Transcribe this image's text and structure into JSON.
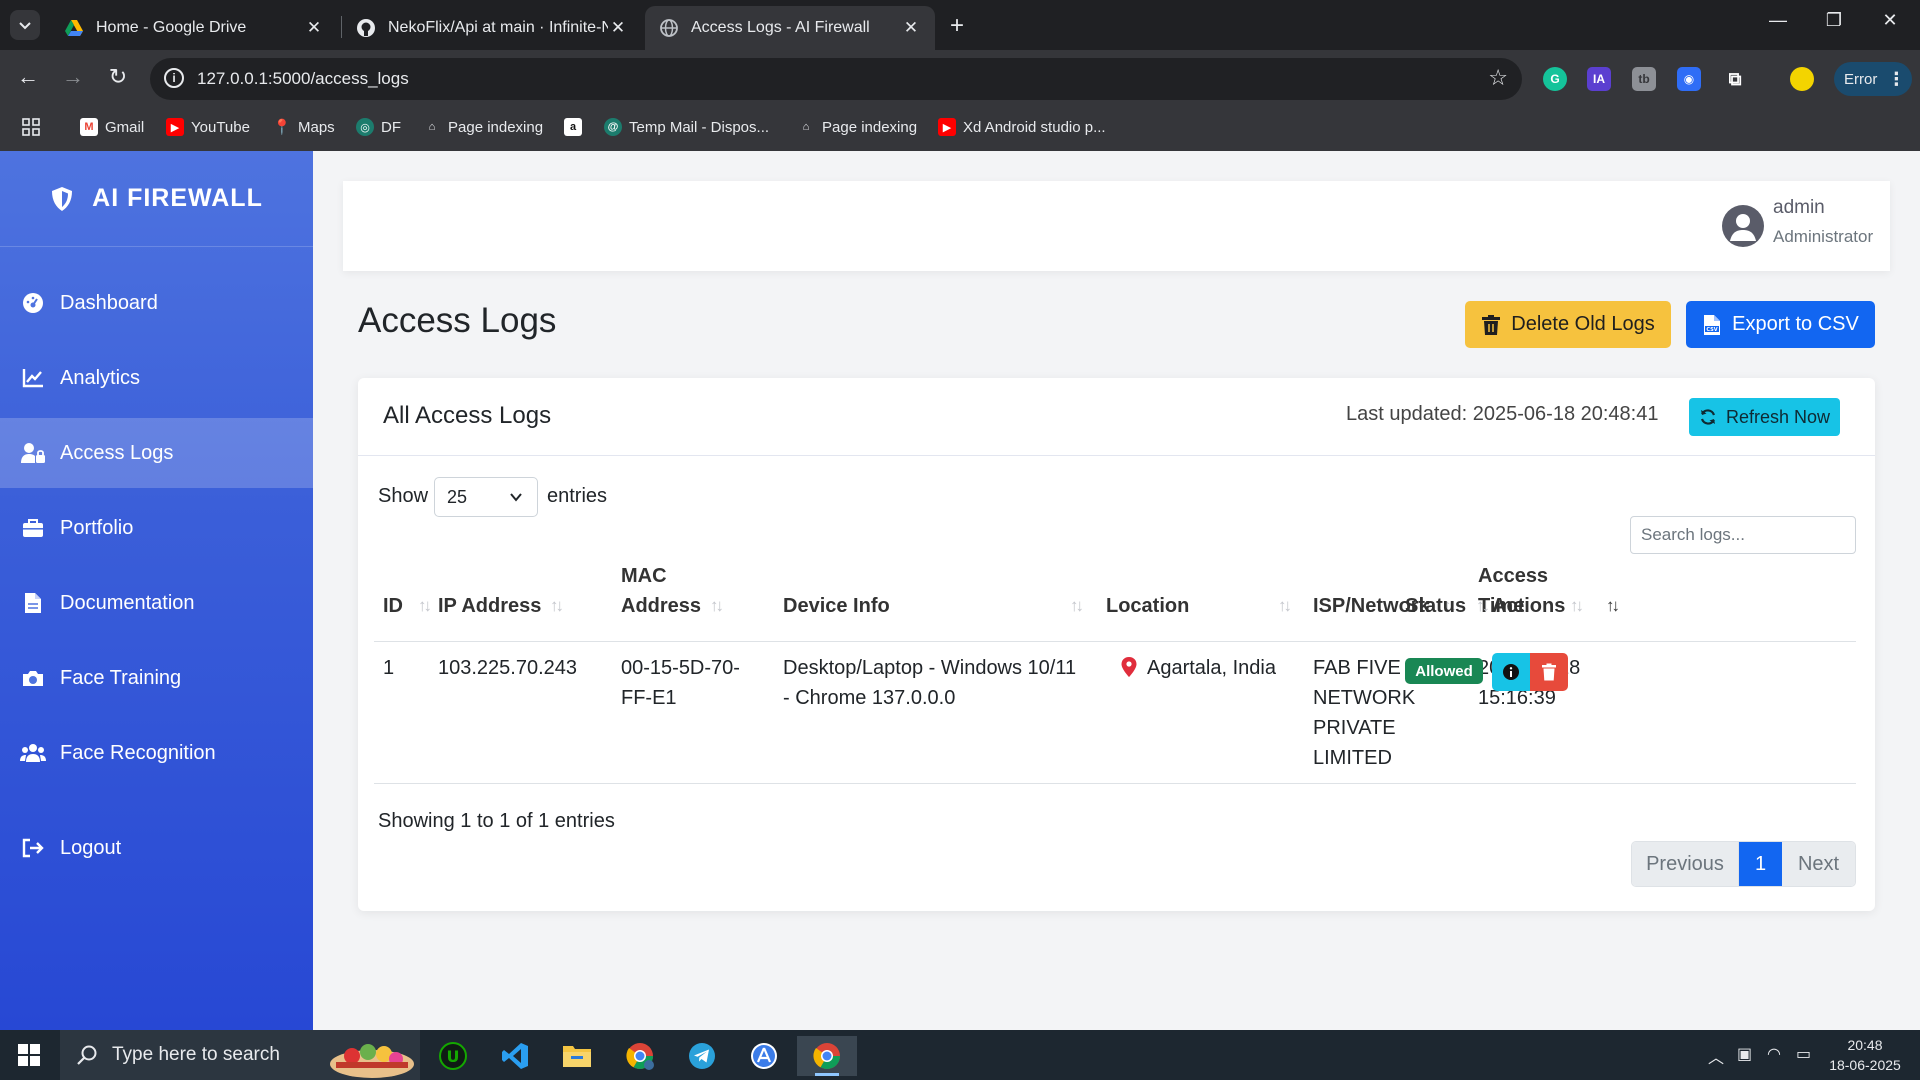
{
  "browser": {
    "tabs": [
      {
        "title": "Home - Google Drive",
        "active": false
      },
      {
        "title": "NekoFlix/Api at main · Infinite-N",
        "active": false
      },
      {
        "title": "Access Logs - AI Firewall",
        "active": true
      }
    ],
    "url": "127.0.0.1:5000/access_logs",
    "profile_status": "Error",
    "bookmarks": [
      {
        "label": "Gmail",
        "icon": "gmail-icon"
      },
      {
        "label": "YouTube",
        "icon": "youtube-icon"
      },
      {
        "label": "Maps",
        "icon": "maps-icon"
      },
      {
        "label": "DF",
        "icon": "df-icon"
      },
      {
        "label": "Page indexing",
        "icon": "search-console-icon"
      },
      {
        "label": "",
        "icon": "amazon-icon"
      },
      {
        "label": "Temp Mail - Dispos...",
        "icon": "temp-mail-icon"
      },
      {
        "label": "Page indexing",
        "icon": "search-console-icon"
      },
      {
        "label": "Xd Android studio p...",
        "icon": "youtube-icon"
      }
    ]
  },
  "sidebar": {
    "brand": "AI FIREWALL",
    "items": [
      {
        "label": "Dashboard",
        "icon": "dashboard-icon",
        "active": false
      },
      {
        "label": "Analytics",
        "icon": "chart-line-icon",
        "active": false
      },
      {
        "label": "Access Logs",
        "icon": "user-lock-icon",
        "active": true
      },
      {
        "label": "Portfolio",
        "icon": "briefcase-icon",
        "active": false
      },
      {
        "label": "Documentation",
        "icon": "file-icon",
        "active": false
      },
      {
        "label": "Face Training",
        "icon": "camera-icon",
        "active": false
      },
      {
        "label": "Face Recognition",
        "icon": "users-icon",
        "active": false
      },
      {
        "label": "Logout",
        "icon": "sign-out-icon",
        "active": false
      }
    ]
  },
  "topbar": {
    "user_name": "admin",
    "user_role": "Administrator"
  },
  "page": {
    "title": "Access Logs",
    "delete_button": "Delete Old Logs",
    "export_button": "Export to CSV"
  },
  "card": {
    "title": "All Access Logs",
    "last_updated": "Last updated: 2025-06-18 20:48:41",
    "refresh_button": "Refresh Now",
    "show_label": "Show",
    "entries_value": "25",
    "entries_label": "entries",
    "search_placeholder": "Search logs...",
    "columns": [
      "ID",
      "IP Address",
      "MAC Address",
      "Device Info",
      "Location",
      "ISP/Network",
      "Access Time",
      "Status",
      "Actions"
    ],
    "rows": [
      {
        "id": "1",
        "ip": "103.225.70.243",
        "mac": "00-15-5D-70-FF-E1",
        "device": "Desktop/Laptop - Windows 10/11 - Chrome 137.0.0.0",
        "location": "Agartala, India",
        "isp": "FAB FIVE NETWORK PRIVATE LIMITED",
        "access_time": "2025-06-18 15:16:39",
        "status": "Allowed"
      }
    ],
    "showing": "Showing 1 to 1 of 1 entries",
    "pagination": {
      "previous": "Previous",
      "current": "1",
      "next": "Next"
    }
  },
  "taskbar": {
    "search_placeholder": "Type here to search",
    "time": "20:48",
    "date": "18-06-2025",
    "apps": [
      "upwork-icon",
      "vscode-icon",
      "file-explorer-icon",
      "chrome-profile-icon",
      "telegram-icon",
      "app-store-icon",
      "chrome-icon"
    ]
  },
  "colors": {
    "sidebar": "#4e73df",
    "primary": "#1266f1",
    "warning": "#f6c23e",
    "info": "#17c3e6",
    "success": "#198754",
    "danger": "#e74a3b"
  }
}
